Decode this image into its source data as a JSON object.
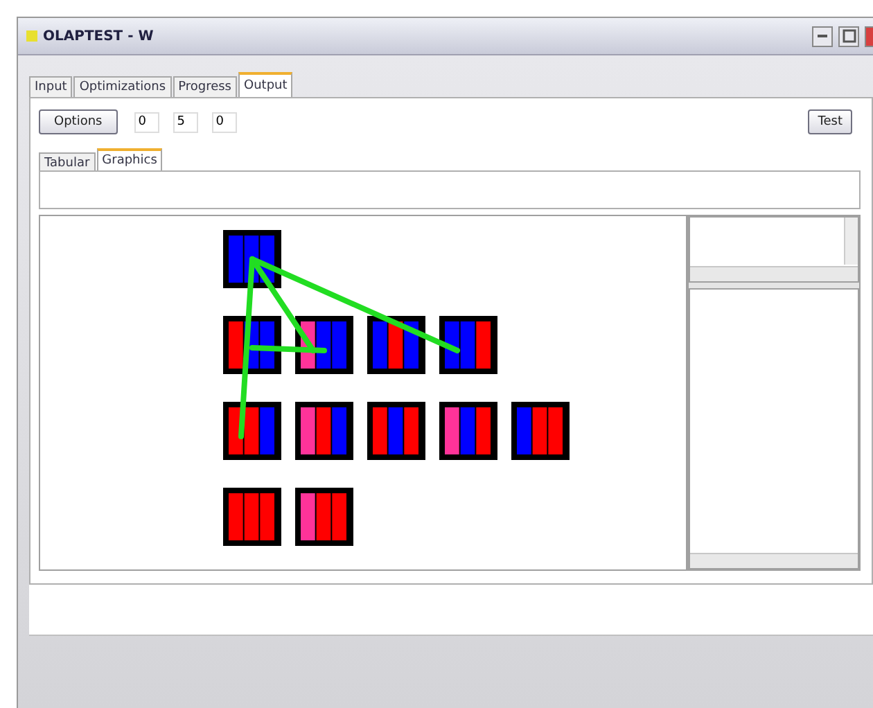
{
  "window": {
    "title": "OLAPTEST - W"
  },
  "tabs": [
    {
      "label": "Input",
      "selected": false
    },
    {
      "label": "Optimizations",
      "selected": false
    },
    {
      "label": "Progress",
      "selected": false
    },
    {
      "label": "Output",
      "selected": true
    }
  ],
  "toolbar": {
    "options_button": "Options",
    "fields": [
      "0",
      "5",
      "0"
    ],
    "test_button": "Test"
  },
  "subtabs": [
    {
      "label": "Tabular",
      "selected": false
    },
    {
      "label": "Graphics",
      "selected": true
    }
  ],
  "graph": {
    "rows": [
      [
        {
          "linked": false,
          "branch": false,
          "stripes": [
            {
              "color": "#0000ff"
            },
            {
              "color": "#0000ff"
            },
            {
              "color": "#0000ff"
            }
          ]
        }
      ],
      [
        {
          "linked": false,
          "branch": false,
          "stripes": [
            {
              "color": "#ff0000"
            },
            {
              "color": "#0000ff"
            },
            {
              "color": "#0000ff"
            }
          ]
        },
        {
          "linked": true,
          "branch": true,
          "stripes": [
            {
              "color": "#ff3399"
            },
            {
              "color": "#0000ff"
            },
            {
              "color": "#0000ff"
            }
          ]
        },
        {
          "linked": false,
          "branch": false,
          "stripes": [
            {
              "color": "#0000ff"
            },
            {
              "color": "#ff0000"
            },
            {
              "color": "#0000ff"
            }
          ]
        },
        {
          "linked": true,
          "branch": false,
          "stripes": [
            {
              "color": "#0000ff"
            },
            {
              "color": "#0000ff"
            },
            {
              "color": "#ff0000"
            }
          ]
        }
      ],
      [
        {
          "linked": true,
          "branch": false,
          "stripes": [
            {
              "color": "#ff0000"
            },
            {
              "color": "#ff0000"
            },
            {
              "color": "#0000ff"
            }
          ]
        },
        {
          "linked": false,
          "branch": false,
          "stripes": [
            {
              "color": "#ff3399"
            },
            {
              "color": "#ff0000"
            },
            {
              "color": "#0000ff"
            }
          ]
        },
        {
          "linked": false,
          "branch": false,
          "stripes": [
            {
              "color": "#ff0000"
            },
            {
              "color": "#0000ff"
            },
            {
              "color": "#ff0000"
            }
          ]
        },
        {
          "linked": false,
          "branch": false,
          "stripes": [
            {
              "color": "#ff3399"
            },
            {
              "color": "#0000ff"
            },
            {
              "color": "#ff0000"
            }
          ]
        },
        {
          "linked": false,
          "branch": false,
          "stripes": [
            {
              "color": "#0000ff"
            },
            {
              "color": "#ff0000"
            },
            {
              "color": "#ff0000"
            }
          ]
        }
      ],
      [
        {
          "linked": false,
          "branch": false,
          "stripes": [
            {
              "color": "#ff0000"
            },
            {
              "color": "#ff0000"
            },
            {
              "color": "#ff0000"
            }
          ]
        },
        {
          "linked": false,
          "branch": false,
          "stripes": [
            {
              "color": "#ff3399"
            },
            {
              "color": "#ff0000"
            },
            {
              "color": "#ff0000"
            }
          ]
        }
      ]
    ]
  }
}
